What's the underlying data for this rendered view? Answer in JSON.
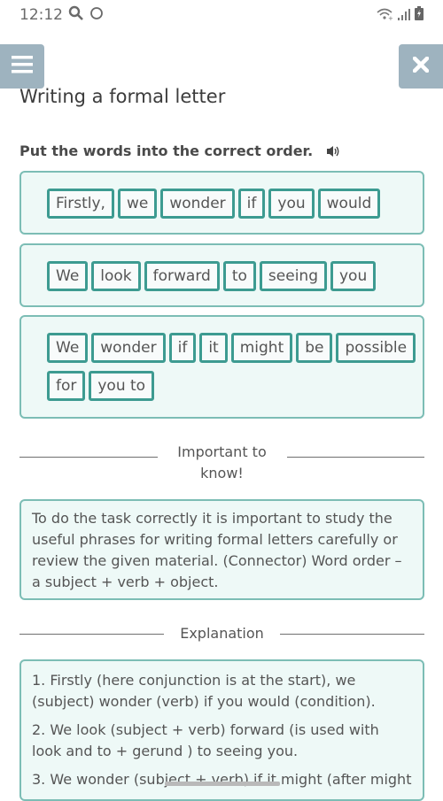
{
  "status_bar": {
    "time": "12:12",
    "left_icons": [
      "search-icon",
      "circle-icon"
    ],
    "right_icons": [
      "wifi-icon",
      "signal-icon",
      "battery-charging-icon"
    ]
  },
  "header": {
    "menu_icon": "hamburger-menu-icon",
    "close_icon": "close-icon",
    "title": "Writing a formal letter"
  },
  "colors": {
    "header_buttons": "#9eb3bf",
    "card_background": "#eef9f7",
    "card_border": "#7cbdb5",
    "word_border": "#3d9b91"
  },
  "exercise": {
    "instruction": "Put the words into the correct order.",
    "audio_icon": "speaker-icon",
    "sentences": [
      {
        "words": [
          "Firstly,",
          "we",
          "wonder",
          "if",
          "you",
          "would"
        ]
      },
      {
        "words": [
          "We",
          "look",
          "forward",
          "to",
          "seeing",
          "you"
        ]
      },
      {
        "words": [
          "We",
          "wonder",
          "if",
          "it",
          "might",
          "be",
          "possible",
          "for",
          "you to"
        ]
      }
    ]
  },
  "important": {
    "heading": "Important to know!",
    "text": "To do the task correctly it is important to study the useful phrases for writing formal letters carefully or review the given material. (Connector) Word order – a subject + verb + object."
  },
  "explanation": {
    "heading": "Explanation",
    "items": [
      "1. Firstly (here conjunction is at the start), we (subject) wonder (verb) if you would (condition).",
      "2. We look (subject + verb) forward (is used with look and to + gerund ) to seeing you.",
      "3. We wonder (subject + verb) if it might (after might"
    ]
  }
}
